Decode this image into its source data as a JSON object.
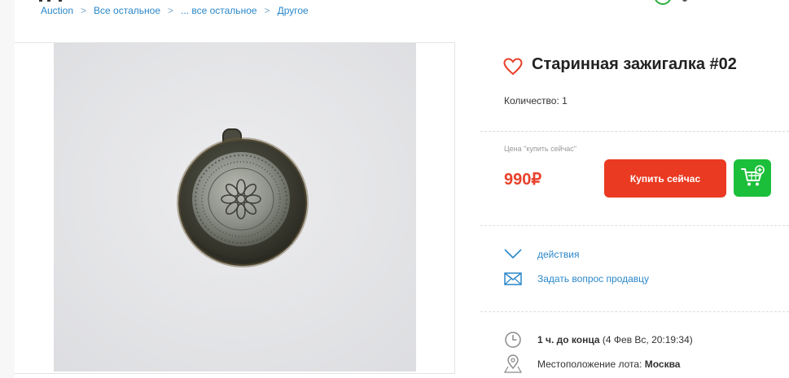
{
  "breadcrumb": {
    "items": [
      "Auction",
      "Все остальное",
      "... все остальное",
      "Другое"
    ],
    "separator": ">"
  },
  "product": {
    "title": "Старинная зажигалка #02",
    "quantity_label": "Количество:",
    "quantity_value": "1"
  },
  "price": {
    "label": "Цена \"купить сейчас\"",
    "value": "990₽",
    "buy_button": "Купить сейчас"
  },
  "actions": {
    "more_label": "действия",
    "ask_seller_label": "Задать вопрос продавцу"
  },
  "lot": {
    "time_left": "1 ч. до конца",
    "end_date": "(4 Фев Вс, 20:19:34)",
    "location_label": "Местоположение лота:",
    "location_value": "Москва"
  },
  "colors": {
    "accent_red": "#ea3a21",
    "cart_green": "#1cbf3a",
    "link_blue": "#2a87c9",
    "price_red": "#e8412b"
  },
  "icons": {
    "favorite": "heart-icon",
    "cart": "cart-plus-icon",
    "actions": "chevron-down-icon",
    "ask": "envelope-icon",
    "time": "clock-icon",
    "location": "map-pin-icon"
  }
}
